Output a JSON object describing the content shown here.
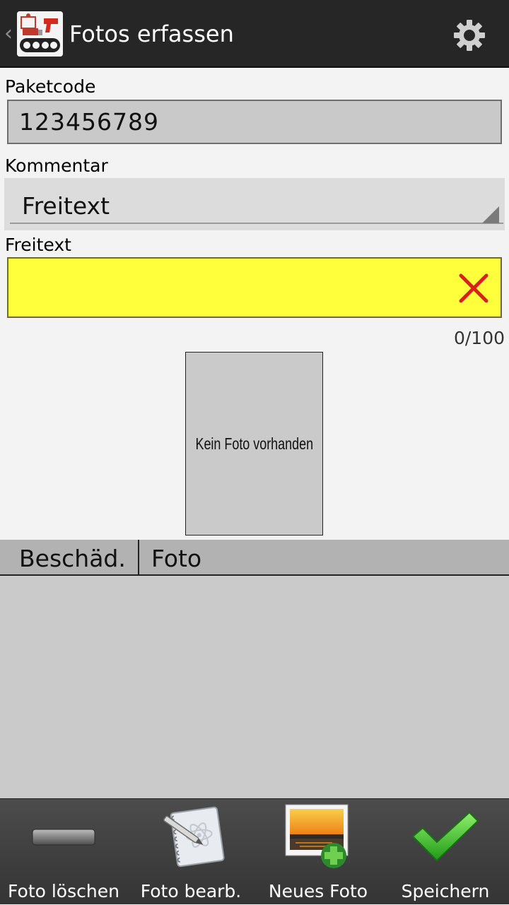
{
  "header": {
    "title": "Fotos erfassen",
    "back_glyph": "‹",
    "logo_icon": "package-scanner-logo-icon",
    "settings_icon": "gear-icon"
  },
  "form": {
    "paketcode": {
      "label": "Paketcode",
      "value": "123456789"
    },
    "kommentar": {
      "label": "Kommentar",
      "selected": "Freitext"
    },
    "freitext": {
      "label": "Freitext",
      "value": "",
      "counter": "0/100",
      "clear_icon": "close-icon",
      "background": "#ffff3c"
    }
  },
  "photo": {
    "placeholder_text": "Kein Foto vorhanden"
  },
  "table": {
    "columns": [
      "Beschäd.",
      "Foto"
    ],
    "rows": []
  },
  "toolbar": {
    "buttons": [
      {
        "label": "Foto löschen",
        "icon": "minus-bar-icon"
      },
      {
        "label": "Foto bearb.",
        "icon": "notepad-pen-icon"
      },
      {
        "label": "Neues Foto",
        "icon": "add-photo-icon"
      },
      {
        "label": "Speichern",
        "icon": "checkmark-icon"
      }
    ]
  },
  "colors": {
    "actionbar": "#262626",
    "highlight_field": "#ffff3c",
    "clear_x": "#d9201a",
    "save_check": "#35b22b"
  }
}
